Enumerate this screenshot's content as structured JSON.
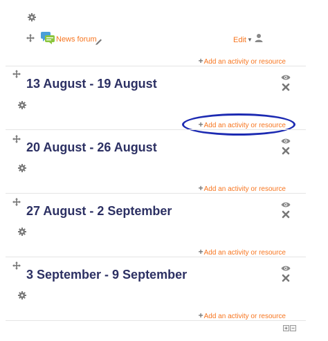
{
  "top_section": {
    "forum_label": "News forum",
    "edit_label": "Edit",
    "add_label": "Add an activity or resource"
  },
  "sections": [
    {
      "title": "13 August - 19 August",
      "add_label": "Add an activity or resource"
    },
    {
      "title": "20 August - 26 August",
      "add_label": "Add an activity or resource"
    },
    {
      "title": "27 August - 2 September",
      "add_label": "Add an activity or resource"
    },
    {
      "title": "3 September - 9 September",
      "add_label": "Add an activity or resource"
    }
  ],
  "icons": {
    "move": "move-icon",
    "settings": "gear-icon",
    "forum": "forum-icon",
    "edit_title": "pencil-icon",
    "role": "user-icon",
    "visibility": "eye-icon",
    "delete": "close-icon"
  },
  "colors": {
    "link": "#f7751f",
    "section_title": "#2c3063",
    "highlight": "#1c2ab2"
  }
}
